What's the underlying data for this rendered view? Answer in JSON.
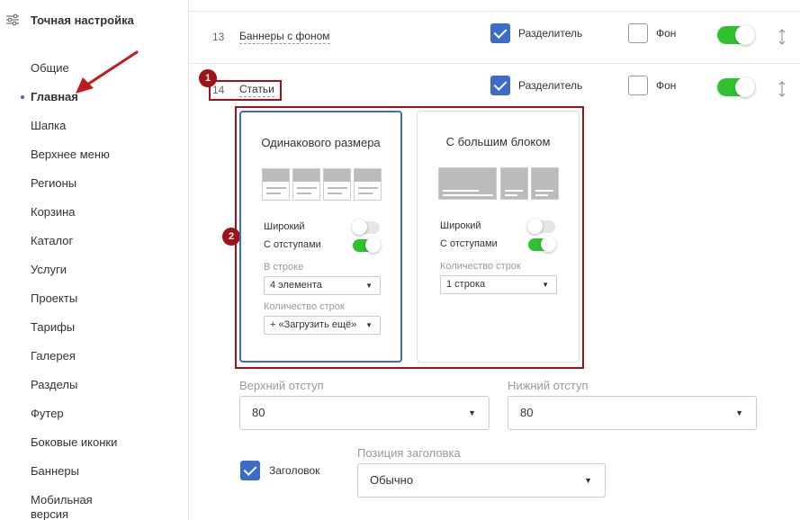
{
  "sidebar": {
    "title": "Точная настройка",
    "items": [
      "Общие",
      "Главная",
      "Шапка",
      "Верхнее меню",
      "Регионы",
      "Корзина",
      "Каталог",
      "Услуги",
      "Проекты",
      "Тарифы",
      "Галерея",
      "Разделы",
      "Футер",
      "Боковые иконки",
      "Баннеры",
      "Мобильная версия"
    ],
    "active_index": 1
  },
  "rows": [
    {
      "num": "13",
      "name": "Баннеры с фоном",
      "divider_label": "Разделитель",
      "divider_checked": true,
      "bg_label": "Фон",
      "bg_checked": false,
      "enabled": true
    },
    {
      "num": "14",
      "name": "Статьи",
      "divider_label": "Разделитель",
      "divider_checked": true,
      "bg_label": "Фон",
      "bg_checked": false,
      "enabled": true
    }
  ],
  "annotations": {
    "badge1": "1",
    "badge2": "2"
  },
  "cards": [
    {
      "title": "Одинакового размера",
      "wide_label": "Широкий",
      "wide_on": false,
      "padding_label": "С отступами",
      "padding_on": true,
      "per_row_label": "В строке",
      "per_row_value": "4 элемента",
      "rows_label": "Количество строк",
      "rows_value": "+ «Загрузить ещё»"
    },
    {
      "title": "С большим блоком",
      "wide_label": "Широкий",
      "wide_on": false,
      "padding_label": "С отступами",
      "padding_on": true,
      "rows_label": "Количество строк",
      "rows_value": "1 строка"
    }
  ],
  "fields": {
    "top_padding_label": "Верхний отступ",
    "top_padding_value": "80",
    "bottom_padding_label": "Нижний отступ",
    "bottom_padding_value": "80",
    "heading_label": "Заголовок",
    "heading_checked": true,
    "heading_pos_label": "Позиция заголовка",
    "heading_pos_value": "Обычно"
  },
  "colors": {
    "accent": "#3b6cc9",
    "toggle_on": "#2ec32e",
    "annotation": "#a01218"
  }
}
